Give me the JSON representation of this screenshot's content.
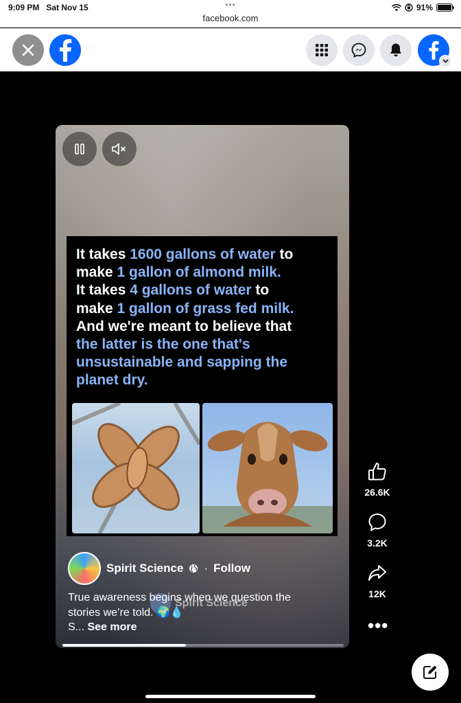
{
  "status_bar": {
    "time": "9:09 PM",
    "date": "Sat Nov 15",
    "url": "facebook.com",
    "battery": "91%",
    "battery_level": 0.91
  },
  "top_bar": {
    "close_icon": "close-icon",
    "logo": "facebook-logo",
    "menu_icon": "grid-menu-icon",
    "messenger_icon": "messenger-icon",
    "notifications_icon": "bell-icon",
    "profile_icon": "profile-avatar",
    "brand_color": "#0866ff"
  },
  "reel": {
    "pause_icon": "pause-icon",
    "mute_icon": "muted-speaker-icon",
    "text_lines": [
      [
        {
          "t": "It takes ",
          "h": false
        },
        {
          "t": "1600 gallons of water",
          "h": true
        },
        {
          "t": " to",
          "h": false
        }
      ],
      [
        {
          "t": "make ",
          "h": false
        },
        {
          "t": "1 gallon of almond milk.",
          "h": true
        }
      ],
      [
        {
          "t": "It takes ",
          "h": false
        },
        {
          "t": "4 gallons of water",
          "h": true
        },
        {
          "t": " to",
          "h": false
        }
      ],
      [
        {
          "t": "make ",
          "h": false
        },
        {
          "t": "1 gallon of grass fed milk.",
          "h": true
        }
      ],
      [
        {
          "t": "And we're meant to believe that",
          "h": false
        }
      ],
      [
        {
          "t": "the latter is the one that's",
          "h": true
        }
      ],
      [
        {
          "t": "unsustainable and sapping the",
          "h": true
        }
      ],
      [
        {
          "t": "planet dry.",
          "h": true
        }
      ]
    ],
    "highlight_color": "#8ab4f8",
    "author": "Spirit Science",
    "globe_icon": "globe-icon",
    "separator": "·",
    "follow": "Follow",
    "caption_line1": "True awareness begins when we question the",
    "caption_line2": "stories we’re told. 🌍💧",
    "caption_line3_prefix": "S...",
    "see_more": "See more",
    "watermark": "Spirit Science",
    "progress": 0.44
  },
  "actions": {
    "likes": "26.6K",
    "comments": "3.2K",
    "shares": "12K",
    "like_icon": "thumbs-up-icon",
    "comment_icon": "comment-icon",
    "share_icon": "share-icon",
    "more_icon": "more-dots-icon",
    "compose_icon": "compose-icon"
  }
}
